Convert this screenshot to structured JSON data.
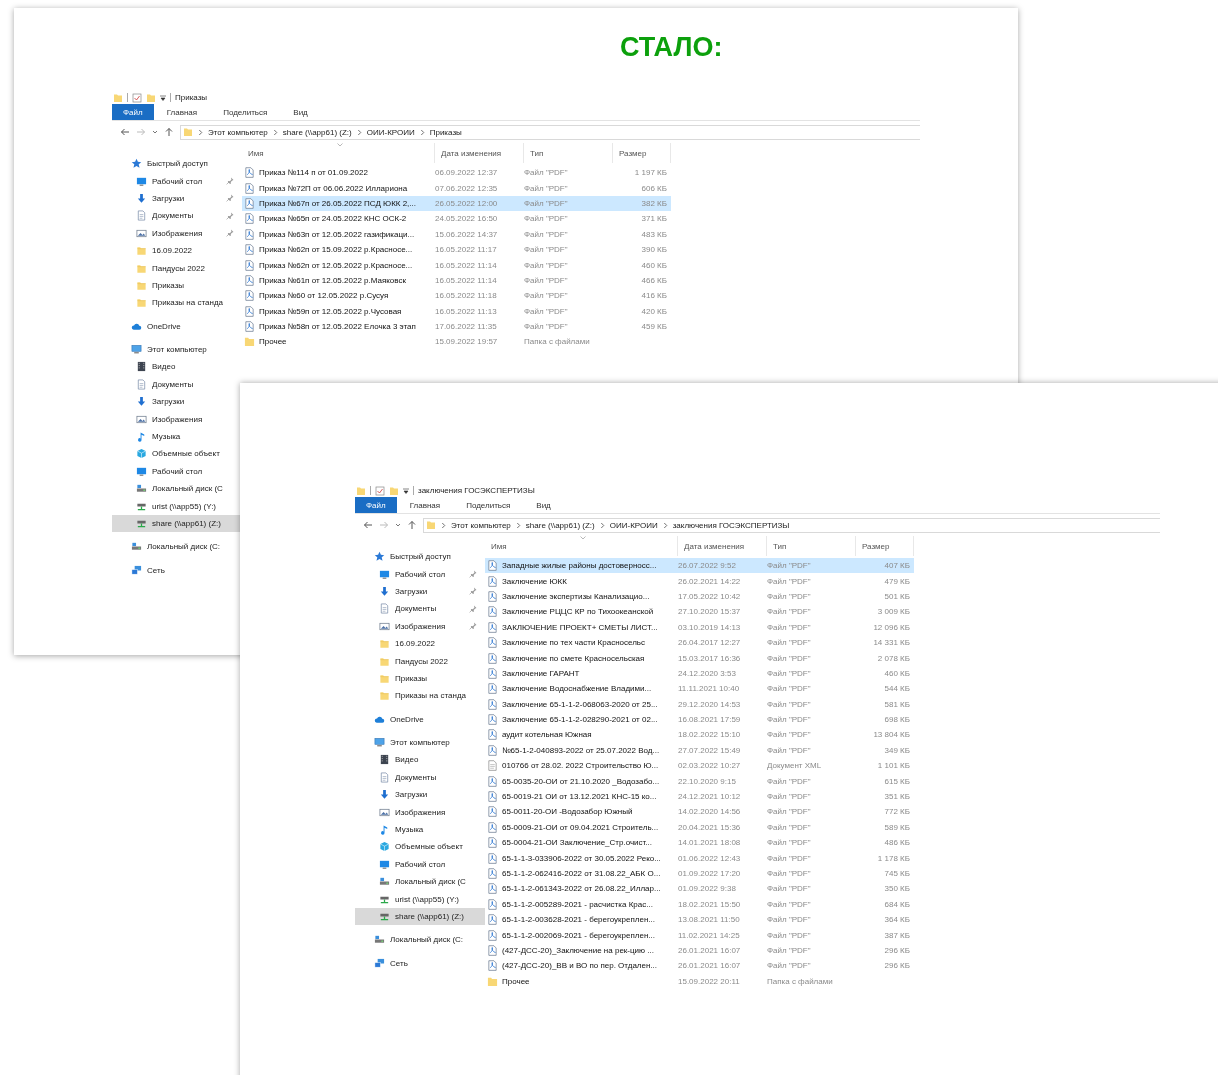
{
  "heading": "СТАЛО:",
  "windows": [
    {
      "title": "Приказы",
      "ribbon_tabs": [
        {
          "label": "Файл",
          "selected": true
        },
        {
          "label": "Главная",
          "selected": false
        },
        {
          "label": "Поделиться",
          "selected": false
        },
        {
          "label": "Вид",
          "selected": false
        }
      ],
      "address": [
        "Этот компьютер",
        "share (\\\\app61) (Z:)",
        "ОИИ-КРОИИ",
        "Приказы"
      ],
      "columns": [
        "Имя",
        "Дата изменения",
        "Тип",
        "Размер"
      ],
      "sidebar": [
        {
          "label": "Быстрый доступ",
          "kind": "star",
          "selected": false,
          "children": [
            {
              "label": "Рабочий стол",
              "kind": "desktop",
              "pinned": true,
              "selected": false
            },
            {
              "label": "Загрузки",
              "kind": "download",
              "pinned": true,
              "selected": false
            },
            {
              "label": "Документы",
              "kind": "documents",
              "pinned": true,
              "selected": false
            },
            {
              "label": "Изображения",
              "kind": "images",
              "pinned": true,
              "selected": false
            },
            {
              "label": "16.09.2022",
              "kind": "folder",
              "pinned": false,
              "selected": false
            },
            {
              "label": "Пандусы 2022",
              "kind": "folder",
              "pinned": false,
              "selected": false
            },
            {
              "label": "Приказы",
              "kind": "folder",
              "pinned": false,
              "selected": false
            },
            {
              "label": "Приказы на станда",
              "kind": "folder",
              "pinned": false,
              "selected": false
            }
          ]
        },
        {
          "label": "OneDrive",
          "kind": "cloud",
          "selected": false
        },
        {
          "label": "Этот компьютер",
          "kind": "computer",
          "selected": false,
          "children": [
            {
              "label": "Видео",
              "kind": "video",
              "selected": false
            },
            {
              "label": "Документы",
              "kind": "documents",
              "selected": false
            },
            {
              "label": "Загрузки",
              "kind": "download",
              "selected": false
            },
            {
              "label": "Изображения",
              "kind": "images",
              "selected": false
            },
            {
              "label": "Музыка",
              "kind": "music",
              "selected": false
            },
            {
              "label": "Объемные объект",
              "kind": "objects",
              "selected": false
            },
            {
              "label": "Рабочий стол",
              "kind": "desktop",
              "selected": false
            },
            {
              "label": "Локальный диск (С",
              "kind": "drive",
              "selected": false
            },
            {
              "label": "urist (\\\\app55) (Y:)",
              "kind": "netdrive",
              "selected": false
            },
            {
              "label": "share (\\\\app61) (Z:)",
              "kind": "netdrive",
              "selected": true
            }
          ]
        },
        {
          "label": "Локальный диск (С:",
          "kind": "drive",
          "selected": false
        },
        {
          "label": "Сеть",
          "kind": "network",
          "selected": false
        }
      ],
      "files": [
        {
          "name": "Приказ №114 п от 01.09.2022",
          "date": "06.09.2022 12:37",
          "type": "Файл \"PDF\"",
          "size": "1 197 КБ",
          "kind": "pdf",
          "selected": false
        },
        {
          "name": "Приказ №72П от 06.06.2022 Иллариона",
          "date": "07.06.2022 12:35",
          "type": "Файл \"PDF\"",
          "size": "606 КБ",
          "kind": "pdf",
          "selected": false
        },
        {
          "name": "Приказ №67п от 26.05.2022 ПСД ЮКК 2,...",
          "date": "26.05.2022 12:00",
          "type": "Файл \"PDF\"",
          "size": "382 КБ",
          "kind": "pdf",
          "selected": true
        },
        {
          "name": "Приказ №65п от 24.05.2022 КНС ОСК-2",
          "date": "24.05.2022 16:50",
          "type": "Файл \"PDF\"",
          "size": "371 КБ",
          "kind": "pdf",
          "selected": false
        },
        {
          "name": "Приказ №63п от 12.05.2022 газификаци...",
          "date": "15.06.2022 14:37",
          "type": "Файл \"PDF\"",
          "size": "483 КБ",
          "kind": "pdf",
          "selected": false
        },
        {
          "name": "Приказ №62п от 15.09.2022 р.Красносе...",
          "date": "16.05.2022 11:17",
          "type": "Файл \"PDF\"",
          "size": "390 КБ",
          "kind": "pdf",
          "selected": false
        },
        {
          "name": "Приказ №62п от 12.05.2022 р.Красносе...",
          "date": "16.05.2022 11:14",
          "type": "Файл \"PDF\"",
          "size": "460 КБ",
          "kind": "pdf",
          "selected": false
        },
        {
          "name": "Приказ №61п от 12.05.2022 р.Маяковск",
          "date": "16.05.2022 11:14",
          "type": "Файл \"PDF\"",
          "size": "466 КБ",
          "kind": "pdf",
          "selected": false
        },
        {
          "name": "Приказ №60 от 12.05.2022 р.Сусуя",
          "date": "16.05.2022 11:18",
          "type": "Файл \"PDF\"",
          "size": "416 КБ",
          "kind": "pdf",
          "selected": false
        },
        {
          "name": "Приказ №59п от 12.05.2022 р.Чусовая",
          "date": "16.05.2022 11:13",
          "type": "Файл \"PDF\"",
          "size": "420 КБ",
          "kind": "pdf",
          "selected": false
        },
        {
          "name": "Приказ №58п от 12.05.2022 Елочка 3 этап",
          "date": "17.06.2022 11:35",
          "type": "Файл \"PDF\"",
          "size": "459 КБ",
          "kind": "pdf",
          "selected": false
        },
        {
          "name": "Прочее",
          "date": "15.09.2022 19:57",
          "type": "Папка с файлами",
          "kind": "folder",
          "selected": false
        }
      ]
    },
    {
      "title": "заключения ГОСЭКСПЕРТИЗЫ",
      "ribbon_tabs": [
        {
          "label": "Файл",
          "selected": true
        },
        {
          "label": "Главная",
          "selected": false
        },
        {
          "label": "Поделиться",
          "selected": false
        },
        {
          "label": "Вид",
          "selected": false
        }
      ],
      "address": [
        "Этот компьютер",
        "share (\\\\app61) (Z:)",
        "ОИИ-КРОИИ",
        "заключения ГОСЭКСПЕРТИЗЫ"
      ],
      "columns": [
        "Имя",
        "Дата изменения",
        "Тип",
        "Размер"
      ],
      "sidebar": [
        {
          "label": "Быстрый доступ",
          "kind": "star",
          "selected": false,
          "children": [
            {
              "label": "Рабочий стол",
              "kind": "desktop",
              "pinned": true,
              "selected": false
            },
            {
              "label": "Загрузки",
              "kind": "download",
              "pinned": true,
              "selected": false
            },
            {
              "label": "Документы",
              "kind": "documents",
              "pinned": true,
              "selected": false
            },
            {
              "label": "Изображения",
              "kind": "images",
              "pinned": true,
              "selected": false
            },
            {
              "label": "16.09.2022",
              "kind": "folder",
              "pinned": false,
              "selected": false
            },
            {
              "label": "Пандусы 2022",
              "kind": "folder",
              "pinned": false,
              "selected": false
            },
            {
              "label": "Приказы",
              "kind": "folder",
              "pinned": false,
              "selected": false
            },
            {
              "label": "Приказы на станда",
              "kind": "folder",
              "pinned": false,
              "selected": false
            }
          ]
        },
        {
          "label": "OneDrive",
          "kind": "cloud",
          "selected": false
        },
        {
          "label": "Этот компьютер",
          "kind": "computer",
          "selected": false,
          "children": [
            {
              "label": "Видео",
              "kind": "video",
              "selected": false
            },
            {
              "label": "Документы",
              "kind": "documents",
              "selected": false
            },
            {
              "label": "Загрузки",
              "kind": "download",
              "selected": false
            },
            {
              "label": "Изображения",
              "kind": "images",
              "selected": false
            },
            {
              "label": "Музыка",
              "kind": "music",
              "selected": false
            },
            {
              "label": "Объемные объект",
              "kind": "objects",
              "selected": false
            },
            {
              "label": "Рабочий стол",
              "kind": "desktop",
              "selected": false
            },
            {
              "label": "Локальный диск (С",
              "kind": "drive",
              "selected": false
            },
            {
              "label": "urist (\\\\app55) (Y:)",
              "kind": "netdrive",
              "selected": false
            },
            {
              "label": "share (\\\\app61) (Z:)",
              "kind": "netdrive",
              "selected": true
            }
          ]
        },
        {
          "label": "Локальный диск (С:",
          "kind": "drive",
          "selected": false
        },
        {
          "label": "Сеть",
          "kind": "network",
          "selected": false
        }
      ],
      "files": [
        {
          "name": "Западные жилые районы достоверносс...",
          "date": "26.07.2022 9:52",
          "type": "Файл \"PDF\"",
          "size": "407 КБ",
          "kind": "pdf",
          "selected": true
        },
        {
          "name": "Заключение ЮКК",
          "date": "26.02.2021 14:22",
          "type": "Файл \"PDF\"",
          "size": "479 КБ",
          "kind": "pdf",
          "selected": false
        },
        {
          "name": "Заключение экспертизы Канализацио...",
          "date": "17.05.2022 10:42",
          "type": "Файл \"PDF\"",
          "size": "501 КБ",
          "kind": "pdf",
          "selected": false
        },
        {
          "name": "Заключение РЦЦС КР по Тихоокеанской",
          "date": "27.10.2020 15:37",
          "type": "Файл \"PDF\"",
          "size": "3 009 КБ",
          "kind": "pdf",
          "selected": false
        },
        {
          "name": "ЗАКЛЮЧЕНИЕ ПРОЕКТ+ СМЕТЫ ЛИСТ...",
          "date": "03.10.2019 14:13",
          "type": "Файл \"PDF\"",
          "size": "12 096 КБ",
          "kind": "pdf",
          "selected": false
        },
        {
          "name": "Заключение по тех части Красносельс",
          "date": "26.04.2017 12:27",
          "type": "Файл \"PDF\"",
          "size": "14 331 КБ",
          "kind": "pdf",
          "selected": false
        },
        {
          "name": "Заключение по смете Красносельская",
          "date": "15.03.2017 16:36",
          "type": "Файл \"PDF\"",
          "size": "2 078 КБ",
          "kind": "pdf",
          "selected": false
        },
        {
          "name": "Заключение ГАРАНТ",
          "date": "24.12.2020 3:53",
          "type": "Файл \"PDF\"",
          "size": "460 КБ",
          "kind": "pdf",
          "selected": false
        },
        {
          "name": "Заключение Водоснабжение Владими...",
          "date": "11.11.2021 10:40",
          "type": "Файл \"PDF\"",
          "size": "544 КБ",
          "kind": "pdf",
          "selected": false
        },
        {
          "name": "Заключение 65-1-1-2-068063-2020 от 25...",
          "date": "29.12.2020 14:53",
          "type": "Файл \"PDF\"",
          "size": "581 КБ",
          "kind": "pdf",
          "selected": false
        },
        {
          "name": "Заключение 65-1-1-2-028290-2021 от 02...",
          "date": "16.08.2021 17:59",
          "type": "Файл \"PDF\"",
          "size": "698 КБ",
          "kind": "pdf",
          "selected": false
        },
        {
          "name": "аудит котельная Южная",
          "date": "18.02.2022 15:10",
          "type": "Файл \"PDF\"",
          "size": "13 804 КБ",
          "kind": "pdf",
          "selected": false
        },
        {
          "name": "№65-1-2-040893-2022 от 25.07.2022 Вод...",
          "date": "27.07.2022 15:49",
          "type": "Файл \"PDF\"",
          "size": "349 КБ",
          "kind": "pdf",
          "selected": false
        },
        {
          "name": "010766 от 28.02. 2022 Строительство Ю...",
          "date": "02.03.2022 10:27",
          "type": "Документ XML",
          "size": "1 101 КБ",
          "kind": "xml",
          "selected": false
        },
        {
          "name": "65-0035-20-ОИ от 21.10.2020 _Водозабо...",
          "date": "22.10.2020 9:15",
          "type": "Файл \"PDF\"",
          "size": "615 КБ",
          "kind": "pdf",
          "selected": false
        },
        {
          "name": "65-0019-21 ОИ от 13.12.2021 КНС-15 ко...",
          "date": "24.12.2021 10:12",
          "type": "Файл \"PDF\"",
          "size": "351 КБ",
          "kind": "pdf",
          "selected": false
        },
        {
          "name": "65-0011-20-ОИ -Водозабор Южный",
          "date": "14.02.2020 14:56",
          "type": "Файл \"PDF\"",
          "size": "772 КБ",
          "kind": "pdf",
          "selected": false
        },
        {
          "name": "65-0009-21-ОИ от 09.04.2021 Строитель...",
          "date": "20.04.2021 15:36",
          "type": "Файл \"PDF\"",
          "size": "589 КБ",
          "kind": "pdf",
          "selected": false
        },
        {
          "name": "65-0004-21-ОИ Заключение_Стр.очист...",
          "date": "14.01.2021 18:08",
          "type": "Файл \"PDF\"",
          "size": "486 КБ",
          "kind": "pdf",
          "selected": false
        },
        {
          "name": "65-1-1-3-033906-2022 от 30.05.2022 Реко...",
          "date": "01.06.2022 12:43",
          "type": "Файл \"PDF\"",
          "size": "1 178 КБ",
          "kind": "pdf",
          "selected": false
        },
        {
          "name": "65-1-1-2-062416-2022 от 31.08.22_АБК О...",
          "date": "01.09.2022 17:20",
          "type": "Файл \"PDF\"",
          "size": "745 КБ",
          "kind": "pdf",
          "selected": false
        },
        {
          "name": "65-1-1-2-061343-2022 от 26.08.22_Иллар...",
          "date": "01.09.2022 9:38",
          "type": "Файл \"PDF\"",
          "size": "350 КБ",
          "kind": "pdf",
          "selected": false
        },
        {
          "name": "65-1-1-2-005289-2021 - расчистка Крас...",
          "date": "18.02.2021 15:50",
          "type": "Файл \"PDF\"",
          "size": "684 КБ",
          "kind": "pdf",
          "selected": false
        },
        {
          "name": "65-1-1-2-003628-2021 - берегоукреплен...",
          "date": "13.08.2021 11:50",
          "type": "Файл \"PDF\"",
          "size": "364 КБ",
          "kind": "pdf",
          "selected": false
        },
        {
          "name": "65-1-1-2-002069-2021 - берегоукреплен...",
          "date": "11.02.2021 14:25",
          "type": "Файл \"PDF\"",
          "size": "387 КБ",
          "kind": "pdf",
          "selected": false
        },
        {
          "name": "(427-ДСС-20)_Заключение на рек-цию ...",
          "date": "26.01.2021 16:07",
          "type": "Файл \"PDF\"",
          "size": "296 КБ",
          "kind": "pdf",
          "selected": false
        },
        {
          "name": "(427-ДСС-20)_ВВ и ВО по пер. Отдален...",
          "date": "26.01.2021 16:07",
          "type": "Файл \"PDF\"",
          "size": "296 КБ",
          "kind": "pdf",
          "selected": false
        },
        {
          "name": "Прочее",
          "date": "15.09.2022 20:11",
          "type": "Папка с файлами",
          "kind": "folder",
          "selected": false
        }
      ]
    }
  ]
}
